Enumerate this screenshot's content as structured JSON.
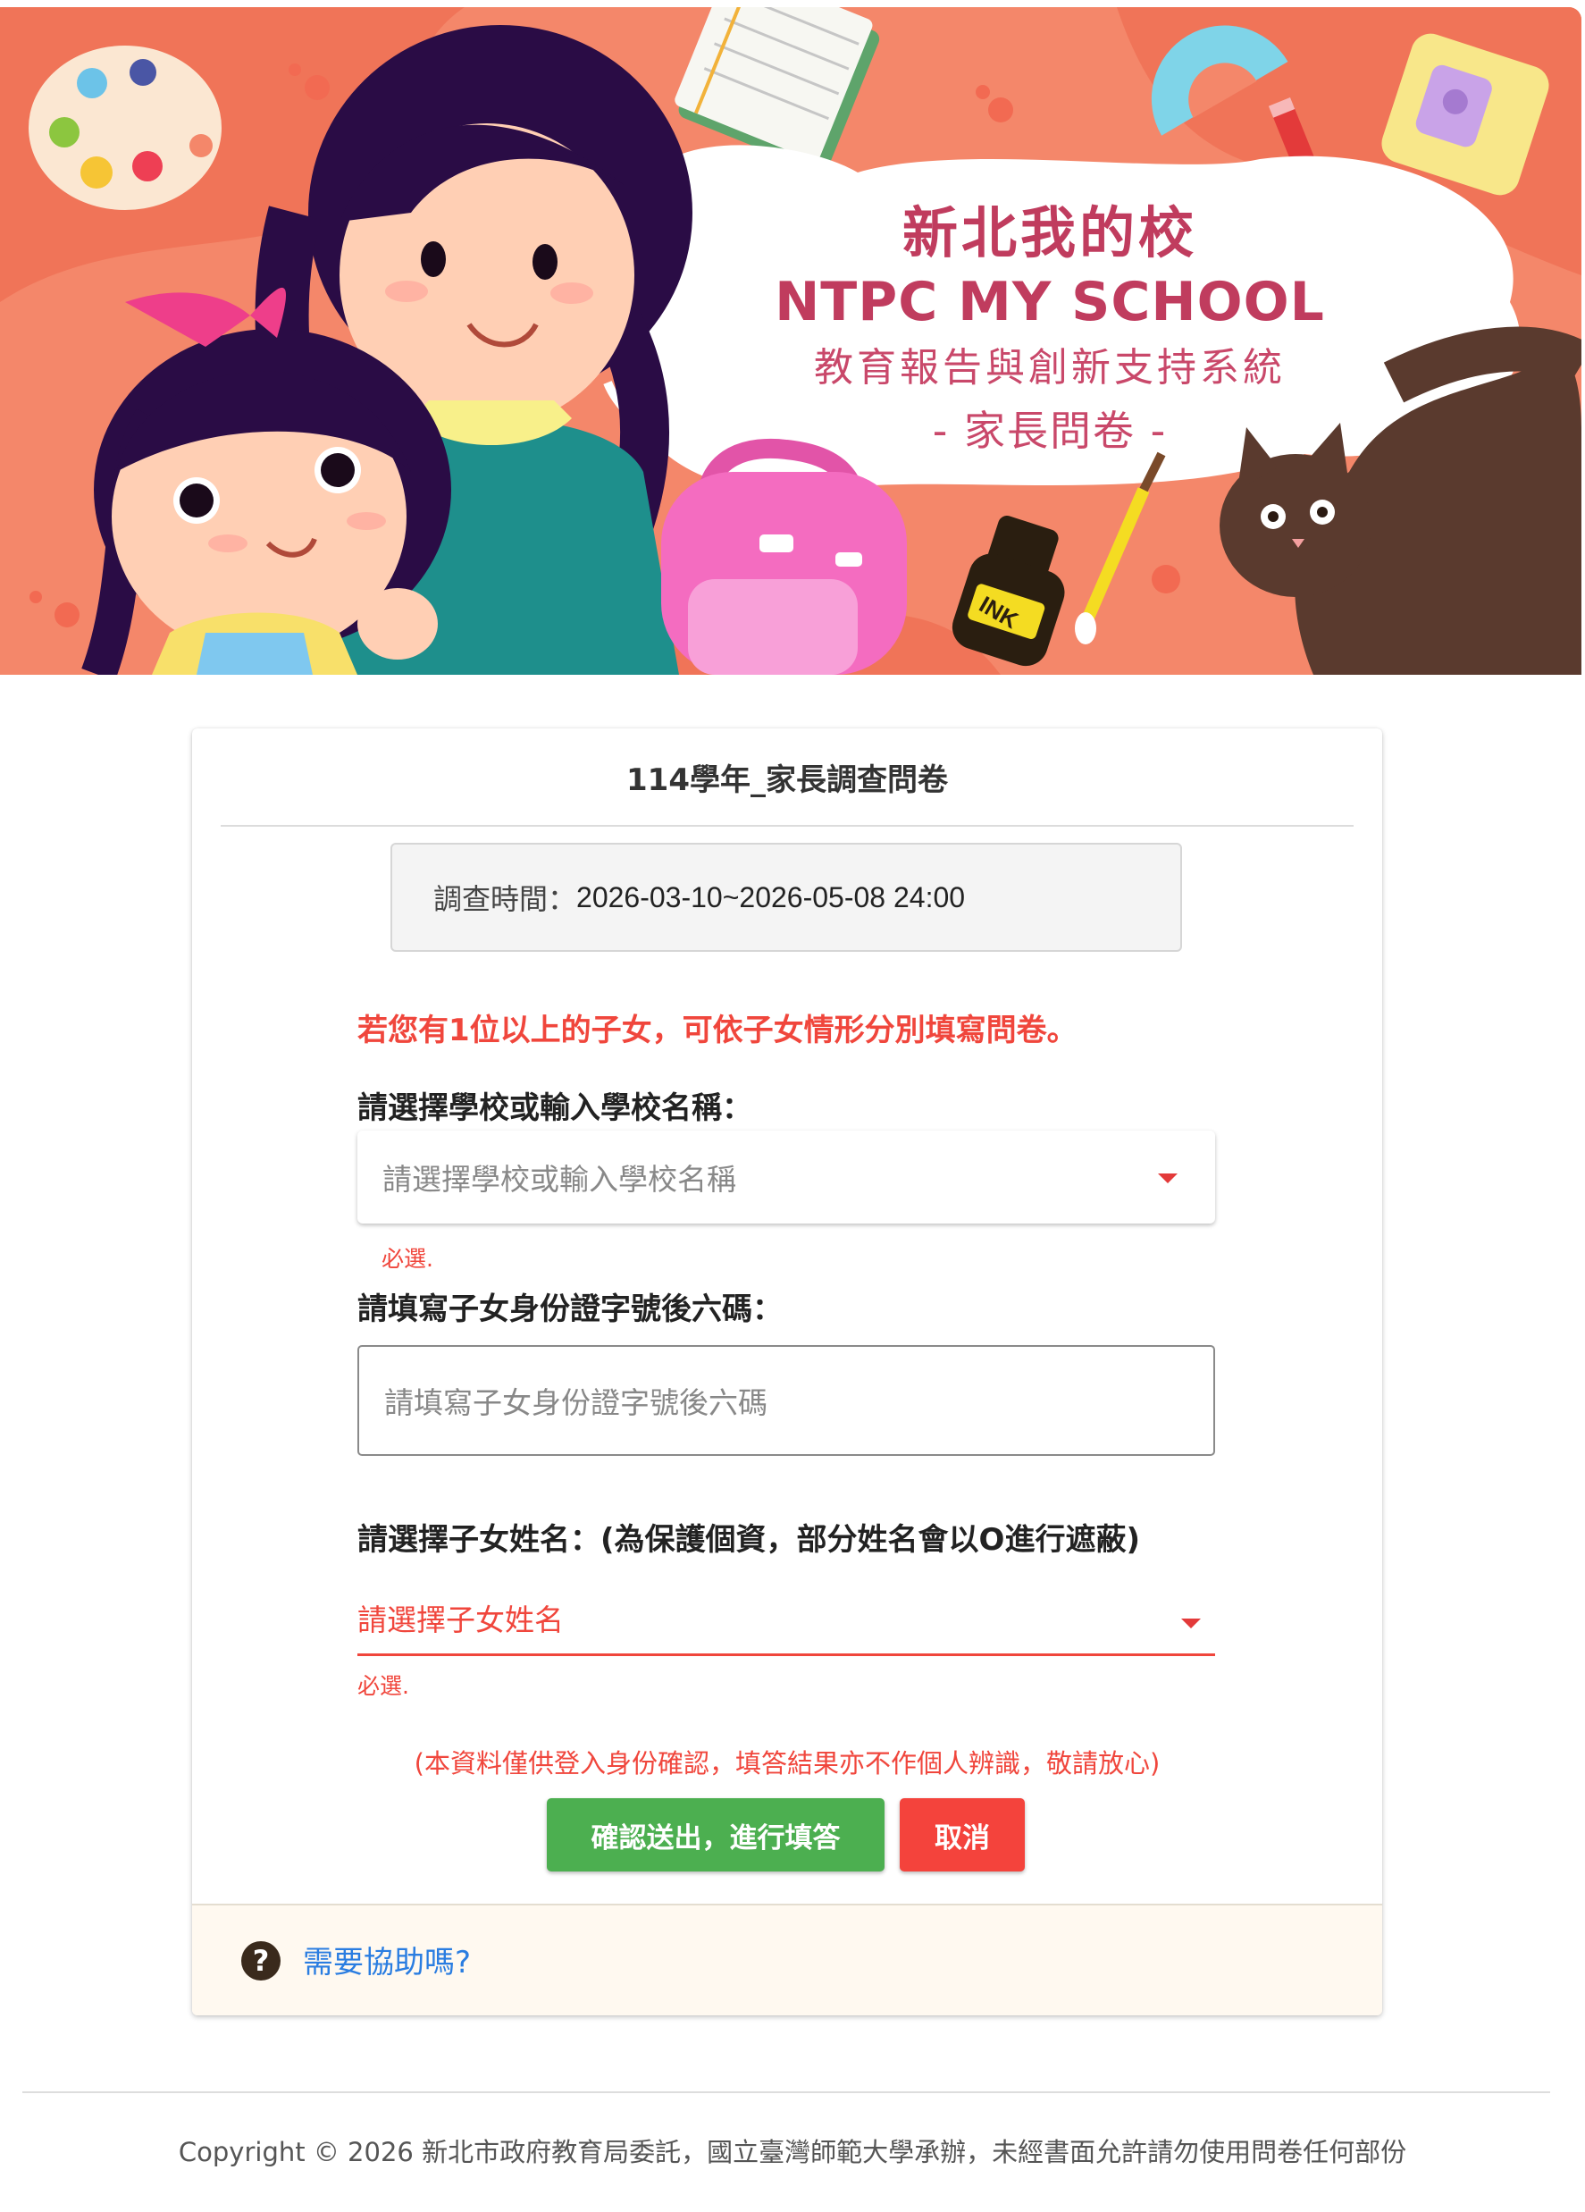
{
  "banner": {
    "title_zh": "新北我的校",
    "title_en": "NTPC MY SCHOOL",
    "subtitle": "教育報告與創新支持系統",
    "subtitle2": "- 家長問卷 -",
    "ink_label": "INK"
  },
  "form": {
    "title": "114學年_家長調查問卷",
    "period_label": "調查時間：",
    "period_value": "2026-03-10~2026-05-08 24:00",
    "notice": "若您有1位以上的子女，可依子女情形分別填寫問卷。",
    "school_label": "請選擇學校或輸入學校名稱：",
    "school_placeholder": "請選擇學校或輸入學校名稱",
    "school_required": "必選.",
    "id_label": "請填寫子女身份證字號後六碼：",
    "id_placeholder": "請填寫子女身份證字號後六碼",
    "child_label": "請選擇子女姓名：(為保護個資，部分姓名會以O進行遮蔽)",
    "child_placeholder": "請選擇子女姓名",
    "child_required": "必選.",
    "privacy_note": "(本資料僅供登入身份確認，填答結果亦不作個人辨識，敬請放心)",
    "confirm_button": "確認送出，進行填答",
    "cancel_button": "取消"
  },
  "help": {
    "icon": "question-circle-icon",
    "link": "需要協助嗎?"
  },
  "footer": {
    "copyright": "Copyright © 2026 新北市政府教育局委託，國立臺灣師範大學承辦，未經書面允許請勿使用問卷任何部份"
  },
  "colors": {
    "banner_bg": "#f4876a",
    "accent_red": "#f0463c",
    "confirm_green": "#4caf50",
    "cancel_red": "#f4433c",
    "link_blue": "#2a7de1"
  }
}
